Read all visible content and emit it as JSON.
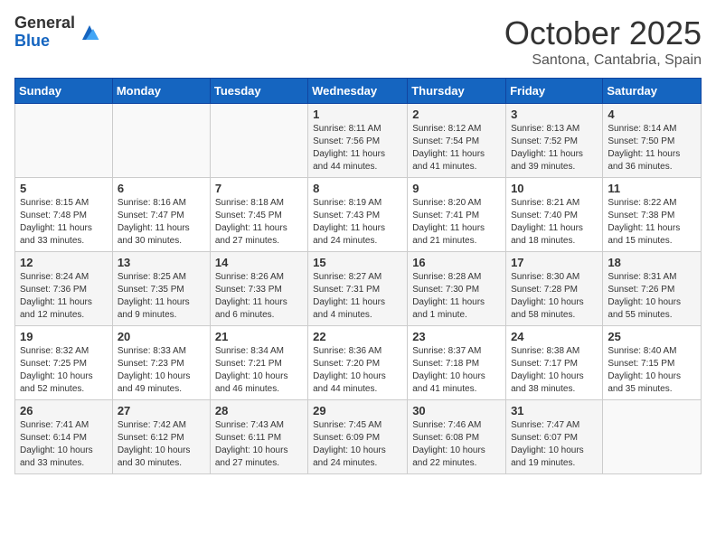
{
  "logo": {
    "general": "General",
    "blue": "Blue"
  },
  "header": {
    "month": "October 2025",
    "location": "Santona, Cantabria, Spain"
  },
  "weekdays": [
    "Sunday",
    "Monday",
    "Tuesday",
    "Wednesday",
    "Thursday",
    "Friday",
    "Saturday"
  ],
  "weeks": [
    [
      {
        "day": "",
        "sunrise": "",
        "sunset": "",
        "daylight": ""
      },
      {
        "day": "",
        "sunrise": "",
        "sunset": "",
        "daylight": ""
      },
      {
        "day": "",
        "sunrise": "",
        "sunset": "",
        "daylight": ""
      },
      {
        "day": "1",
        "sunrise": "Sunrise: 8:11 AM",
        "sunset": "Sunset: 7:56 PM",
        "daylight": "Daylight: 11 hours and 44 minutes."
      },
      {
        "day": "2",
        "sunrise": "Sunrise: 8:12 AM",
        "sunset": "Sunset: 7:54 PM",
        "daylight": "Daylight: 11 hours and 41 minutes."
      },
      {
        "day": "3",
        "sunrise": "Sunrise: 8:13 AM",
        "sunset": "Sunset: 7:52 PM",
        "daylight": "Daylight: 11 hours and 39 minutes."
      },
      {
        "day": "4",
        "sunrise": "Sunrise: 8:14 AM",
        "sunset": "Sunset: 7:50 PM",
        "daylight": "Daylight: 11 hours and 36 minutes."
      }
    ],
    [
      {
        "day": "5",
        "sunrise": "Sunrise: 8:15 AM",
        "sunset": "Sunset: 7:48 PM",
        "daylight": "Daylight: 11 hours and 33 minutes."
      },
      {
        "day": "6",
        "sunrise": "Sunrise: 8:16 AM",
        "sunset": "Sunset: 7:47 PM",
        "daylight": "Daylight: 11 hours and 30 minutes."
      },
      {
        "day": "7",
        "sunrise": "Sunrise: 8:18 AM",
        "sunset": "Sunset: 7:45 PM",
        "daylight": "Daylight: 11 hours and 27 minutes."
      },
      {
        "day": "8",
        "sunrise": "Sunrise: 8:19 AM",
        "sunset": "Sunset: 7:43 PM",
        "daylight": "Daylight: 11 hours and 24 minutes."
      },
      {
        "day": "9",
        "sunrise": "Sunrise: 8:20 AM",
        "sunset": "Sunset: 7:41 PM",
        "daylight": "Daylight: 11 hours and 21 minutes."
      },
      {
        "day": "10",
        "sunrise": "Sunrise: 8:21 AM",
        "sunset": "Sunset: 7:40 PM",
        "daylight": "Daylight: 11 hours and 18 minutes."
      },
      {
        "day": "11",
        "sunrise": "Sunrise: 8:22 AM",
        "sunset": "Sunset: 7:38 PM",
        "daylight": "Daylight: 11 hours and 15 minutes."
      }
    ],
    [
      {
        "day": "12",
        "sunrise": "Sunrise: 8:24 AM",
        "sunset": "Sunset: 7:36 PM",
        "daylight": "Daylight: 11 hours and 12 minutes."
      },
      {
        "day": "13",
        "sunrise": "Sunrise: 8:25 AM",
        "sunset": "Sunset: 7:35 PM",
        "daylight": "Daylight: 11 hours and 9 minutes."
      },
      {
        "day": "14",
        "sunrise": "Sunrise: 8:26 AM",
        "sunset": "Sunset: 7:33 PM",
        "daylight": "Daylight: 11 hours and 6 minutes."
      },
      {
        "day": "15",
        "sunrise": "Sunrise: 8:27 AM",
        "sunset": "Sunset: 7:31 PM",
        "daylight": "Daylight: 11 hours and 4 minutes."
      },
      {
        "day": "16",
        "sunrise": "Sunrise: 8:28 AM",
        "sunset": "Sunset: 7:30 PM",
        "daylight": "Daylight: 11 hours and 1 minute."
      },
      {
        "day": "17",
        "sunrise": "Sunrise: 8:30 AM",
        "sunset": "Sunset: 7:28 PM",
        "daylight": "Daylight: 10 hours and 58 minutes."
      },
      {
        "day": "18",
        "sunrise": "Sunrise: 8:31 AM",
        "sunset": "Sunset: 7:26 PM",
        "daylight": "Daylight: 10 hours and 55 minutes."
      }
    ],
    [
      {
        "day": "19",
        "sunrise": "Sunrise: 8:32 AM",
        "sunset": "Sunset: 7:25 PM",
        "daylight": "Daylight: 10 hours and 52 minutes."
      },
      {
        "day": "20",
        "sunrise": "Sunrise: 8:33 AM",
        "sunset": "Sunset: 7:23 PM",
        "daylight": "Daylight: 10 hours and 49 minutes."
      },
      {
        "day": "21",
        "sunrise": "Sunrise: 8:34 AM",
        "sunset": "Sunset: 7:21 PM",
        "daylight": "Daylight: 10 hours and 46 minutes."
      },
      {
        "day": "22",
        "sunrise": "Sunrise: 8:36 AM",
        "sunset": "Sunset: 7:20 PM",
        "daylight": "Daylight: 10 hours and 44 minutes."
      },
      {
        "day": "23",
        "sunrise": "Sunrise: 8:37 AM",
        "sunset": "Sunset: 7:18 PM",
        "daylight": "Daylight: 10 hours and 41 minutes."
      },
      {
        "day": "24",
        "sunrise": "Sunrise: 8:38 AM",
        "sunset": "Sunset: 7:17 PM",
        "daylight": "Daylight: 10 hours and 38 minutes."
      },
      {
        "day": "25",
        "sunrise": "Sunrise: 8:40 AM",
        "sunset": "Sunset: 7:15 PM",
        "daylight": "Daylight: 10 hours and 35 minutes."
      }
    ],
    [
      {
        "day": "26",
        "sunrise": "Sunrise: 7:41 AM",
        "sunset": "Sunset: 6:14 PM",
        "daylight": "Daylight: 10 hours and 33 minutes."
      },
      {
        "day": "27",
        "sunrise": "Sunrise: 7:42 AM",
        "sunset": "Sunset: 6:12 PM",
        "daylight": "Daylight: 10 hours and 30 minutes."
      },
      {
        "day": "28",
        "sunrise": "Sunrise: 7:43 AM",
        "sunset": "Sunset: 6:11 PM",
        "daylight": "Daylight: 10 hours and 27 minutes."
      },
      {
        "day": "29",
        "sunrise": "Sunrise: 7:45 AM",
        "sunset": "Sunset: 6:09 PM",
        "daylight": "Daylight: 10 hours and 24 minutes."
      },
      {
        "day": "30",
        "sunrise": "Sunrise: 7:46 AM",
        "sunset": "Sunset: 6:08 PM",
        "daylight": "Daylight: 10 hours and 22 minutes."
      },
      {
        "day": "31",
        "sunrise": "Sunrise: 7:47 AM",
        "sunset": "Sunset: 6:07 PM",
        "daylight": "Daylight: 10 hours and 19 minutes."
      },
      {
        "day": "",
        "sunrise": "",
        "sunset": "",
        "daylight": ""
      }
    ]
  ]
}
